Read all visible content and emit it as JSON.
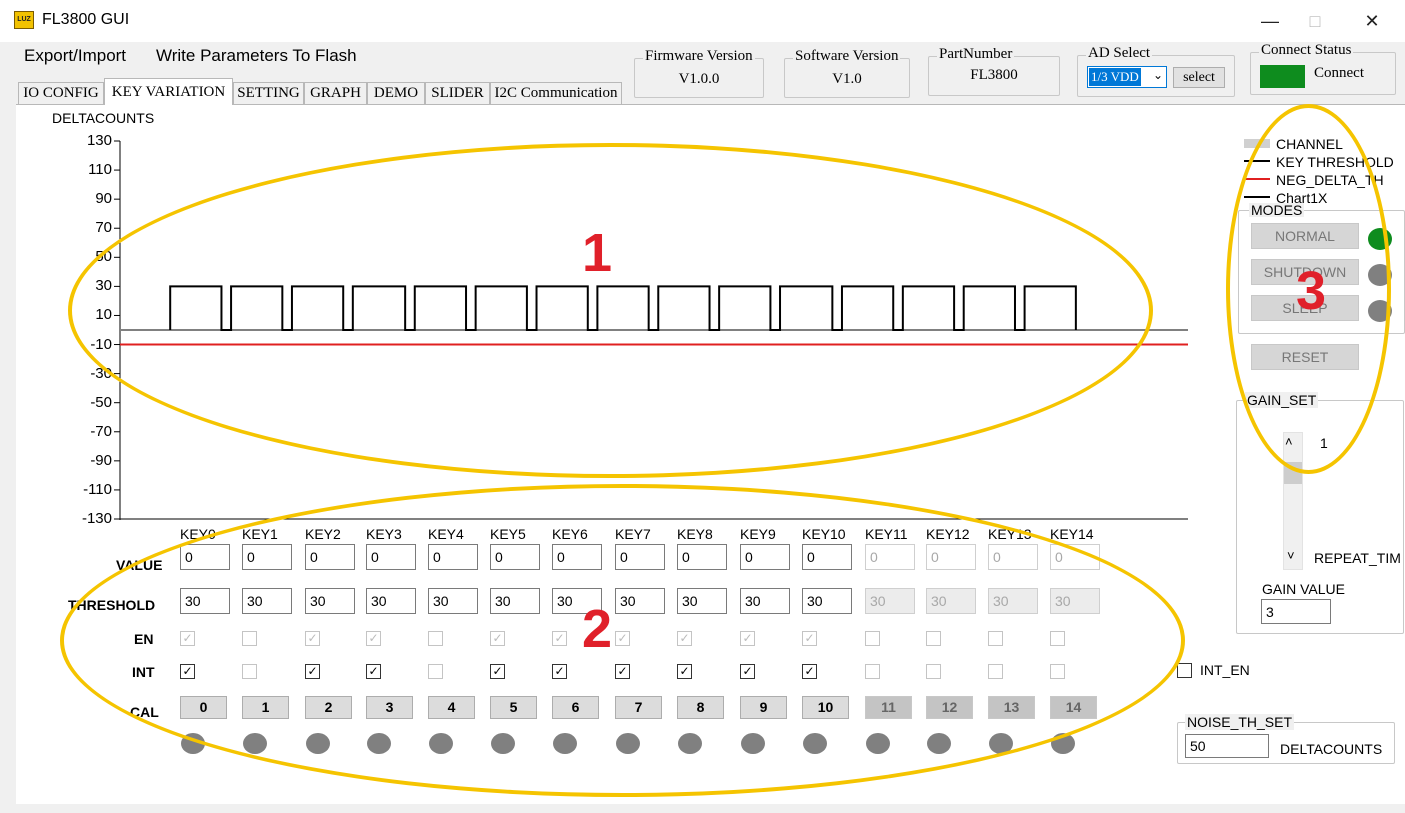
{
  "window": {
    "title": "FL3800 GUI",
    "icon_text": "LUZ"
  },
  "menu": {
    "items": [
      "Export/Import",
      "Write Parameters To Flash"
    ]
  },
  "info": {
    "firmware": {
      "label": "Firmware Version",
      "value": "V1.0.0"
    },
    "software": {
      "label": "Software Version",
      "value": "V1.0"
    },
    "partnumber": {
      "label": "PartNumber",
      "value": "FL3800"
    },
    "ad_select": {
      "label": "AD Select",
      "selected": "1/3 VDD",
      "button": "select"
    },
    "connect": {
      "label": "Connect Status",
      "status": "Connect",
      "color": "#0e8c1e"
    }
  },
  "tabs": [
    "IO CONFIG",
    "KEY VARIATION",
    "SETTING",
    "GRAPH",
    "DEMO",
    "SLIDER",
    "I2C Communication"
  ],
  "active_tab": 1,
  "chart_data": {
    "type": "line",
    "ylabel": "DELTACOUNTS",
    "yticks": [
      130,
      110,
      90,
      70,
      50,
      30,
      10,
      -10,
      -30,
      -50,
      -70,
      -90,
      -110,
      -130
    ],
    "ylim": [
      -130,
      130
    ],
    "xlim": [
      0,
      100
    ],
    "grid": false,
    "series": [
      {
        "name": "CHANNEL",
        "color": "#808080",
        "type": "hline",
        "y": 0
      },
      {
        "name": "KEY THRESHOLD",
        "color": "#000000",
        "type": "pulse",
        "high": 30,
        "low": 0,
        "pulses": [
          [
            4.7,
            9.5
          ],
          [
            10.4,
            15.2
          ],
          [
            16.1,
            20.9
          ],
          [
            21.8,
            26.7
          ],
          [
            27.6,
            32.4
          ],
          [
            33.3,
            38.1
          ],
          [
            39.0,
            43.8
          ],
          [
            44.7,
            49.5
          ],
          [
            50.4,
            55.2
          ],
          [
            56.1,
            60.9
          ],
          [
            61.8,
            66.7
          ],
          [
            67.6,
            72.4
          ],
          [
            73.3,
            78.1
          ],
          [
            79.0,
            83.8
          ],
          [
            84.7,
            89.5
          ]
        ]
      },
      {
        "name": "NEG_DELTA_TH",
        "color": "#e02020",
        "type": "hline",
        "y": -10
      },
      {
        "name": "Chart1X",
        "color": "#000000",
        "type": "none"
      }
    ],
    "legend": [
      "CHANNEL",
      "KEY THRESHOLD",
      "NEG_DELTA_TH",
      "Chart1X"
    ],
    "legend_position": "right"
  },
  "keys": {
    "row_labels": {
      "value": "VALUE",
      "threshold": "THRESHOLD",
      "en": "EN",
      "int": "INT",
      "cal": "CAL"
    },
    "items": [
      {
        "label": "KEY0",
        "value": "0",
        "threshold": "30",
        "en": true,
        "int": true,
        "cal": "0",
        "enabled": true
      },
      {
        "label": "KEY1",
        "value": "0",
        "threshold": "30",
        "en": false,
        "int": false,
        "cal": "1",
        "enabled": true
      },
      {
        "label": "KEY2",
        "value": "0",
        "threshold": "30",
        "en": true,
        "int": true,
        "cal": "2",
        "enabled": true
      },
      {
        "label": "KEY3",
        "value": "0",
        "threshold": "30",
        "en": true,
        "int": true,
        "cal": "3",
        "enabled": true
      },
      {
        "label": "KEY4",
        "value": "0",
        "threshold": "30",
        "en": false,
        "int": false,
        "cal": "4",
        "enabled": true
      },
      {
        "label": "KEY5",
        "value": "0",
        "threshold": "30",
        "en": true,
        "int": true,
        "cal": "5",
        "enabled": true
      },
      {
        "label": "KEY6",
        "value": "0",
        "threshold": "30",
        "en": true,
        "int": true,
        "cal": "6",
        "enabled": true
      },
      {
        "label": "KEY7",
        "value": "0",
        "threshold": "30",
        "en": true,
        "int": true,
        "cal": "7",
        "enabled": true
      },
      {
        "label": "KEY8",
        "value": "0",
        "threshold": "30",
        "en": true,
        "int": true,
        "cal": "8",
        "enabled": true
      },
      {
        "label": "KEY9",
        "value": "0",
        "threshold": "30",
        "en": true,
        "int": true,
        "cal": "9",
        "enabled": true
      },
      {
        "label": "KEY10",
        "value": "0",
        "threshold": "30",
        "en": true,
        "int": true,
        "cal": "10",
        "enabled": true
      },
      {
        "label": "KEY11",
        "value": "0",
        "threshold": "30",
        "en": false,
        "int": false,
        "cal": "11",
        "enabled": false
      },
      {
        "label": "KEY12",
        "value": "0",
        "threshold": "30",
        "en": false,
        "int": false,
        "cal": "12",
        "enabled": false
      },
      {
        "label": "KEY13",
        "value": "0",
        "threshold": "30",
        "en": false,
        "int": false,
        "cal": "13",
        "enabled": false
      },
      {
        "label": "KEY14",
        "value": "0",
        "threshold": "30",
        "en": false,
        "int": false,
        "cal": "14",
        "enabled": false
      }
    ]
  },
  "modes": {
    "title": "MODES",
    "items": [
      {
        "label": "NORMAL",
        "led": "#0e8c1e"
      },
      {
        "label": "SHUTDOWN",
        "led": "#808080"
      },
      {
        "label": "SLEEP",
        "led": "#808080"
      }
    ],
    "reset": "RESET"
  },
  "gain": {
    "title": "GAIN_SET",
    "value_shown": "1",
    "repeat_label": "REPEAT_TIM",
    "gain_value_label": "GAIN VALUE",
    "gain_value": "3"
  },
  "int_en": {
    "label": "INT_EN",
    "checked": false
  },
  "noise": {
    "title": "NOISE_TH_SET",
    "value": "50",
    "unit": "DELTACOUNTS"
  },
  "annotations": [
    "1",
    "2",
    "3"
  ],
  "annotation_color": "#f5c400"
}
